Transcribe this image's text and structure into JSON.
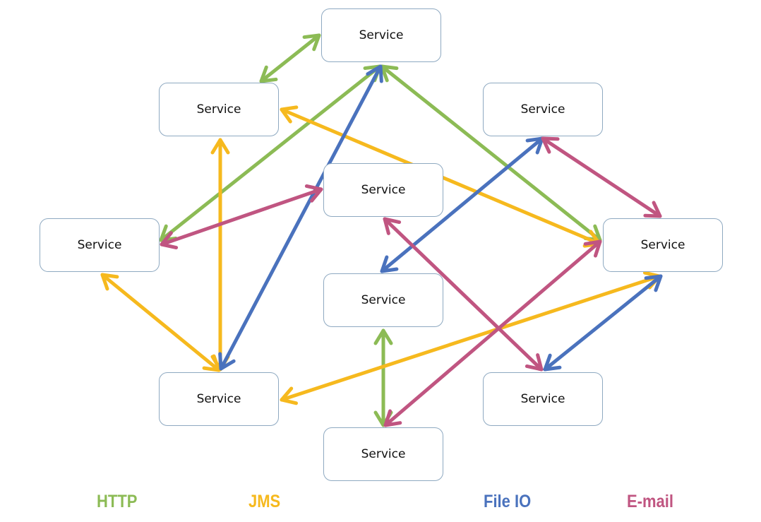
{
  "colors": {
    "HTTP": "#8cbb55",
    "JMS": "#f6b91e",
    "FileIO": "#4a72bd",
    "Email": "#c05581",
    "node_border": "#8ea9c1"
  },
  "nodes": [
    {
      "id": "n1",
      "label": "Service"
    },
    {
      "id": "n2",
      "label": "Service"
    },
    {
      "id": "n3",
      "label": "Service"
    },
    {
      "id": "n4",
      "label": "Service"
    },
    {
      "id": "n5",
      "label": "Service"
    },
    {
      "id": "n6",
      "label": "Service"
    },
    {
      "id": "n7",
      "label": "Service"
    },
    {
      "id": "n8",
      "label": "Service"
    },
    {
      "id": "n9",
      "label": "Service"
    },
    {
      "id": "n10",
      "label": "Service"
    }
  ],
  "edges": [
    {
      "from": "n1",
      "to": "n2",
      "protocol": "HTTP",
      "bidirectional": true
    },
    {
      "from": "n1",
      "to": "n5",
      "protocol": "HTTP",
      "bidirectional": true
    },
    {
      "from": "n1",
      "to": "n6",
      "protocol": "HTTP",
      "bidirectional": true
    },
    {
      "from": "n7",
      "to": "n10",
      "protocol": "HTTP",
      "bidirectional": true
    },
    {
      "from": "n2",
      "to": "n8",
      "protocol": "JMS",
      "bidirectional": true
    },
    {
      "from": "n2",
      "to": "n6",
      "protocol": "JMS",
      "bidirectional": true
    },
    {
      "from": "n5",
      "to": "n8",
      "protocol": "JMS",
      "bidirectional": true
    },
    {
      "from": "n8",
      "to": "n6",
      "protocol": "JMS",
      "bidirectional": true
    },
    {
      "from": "n1",
      "to": "n8",
      "protocol": "FileIO",
      "bidirectional": true
    },
    {
      "from": "n3",
      "to": "n7",
      "protocol": "FileIO",
      "bidirectional": true
    },
    {
      "from": "n6",
      "to": "n9",
      "protocol": "FileIO",
      "bidirectional": true
    },
    {
      "from": "n5",
      "to": "n4",
      "protocol": "Email",
      "bidirectional": true
    },
    {
      "from": "n3",
      "to": "n6",
      "protocol": "Email",
      "bidirectional": true
    },
    {
      "from": "n4",
      "to": "n9",
      "protocol": "Email",
      "bidirectional": true
    },
    {
      "from": "n6",
      "to": "n10",
      "protocol": "Email",
      "bidirectional": true
    }
  ],
  "legend": [
    {
      "key": "HTTP",
      "label": "HTTP"
    },
    {
      "key": "JMS",
      "label": "JMS"
    },
    {
      "key": "FileIO",
      "label": "File IO"
    },
    {
      "key": "Email",
      "label": "E-mail"
    }
  ]
}
